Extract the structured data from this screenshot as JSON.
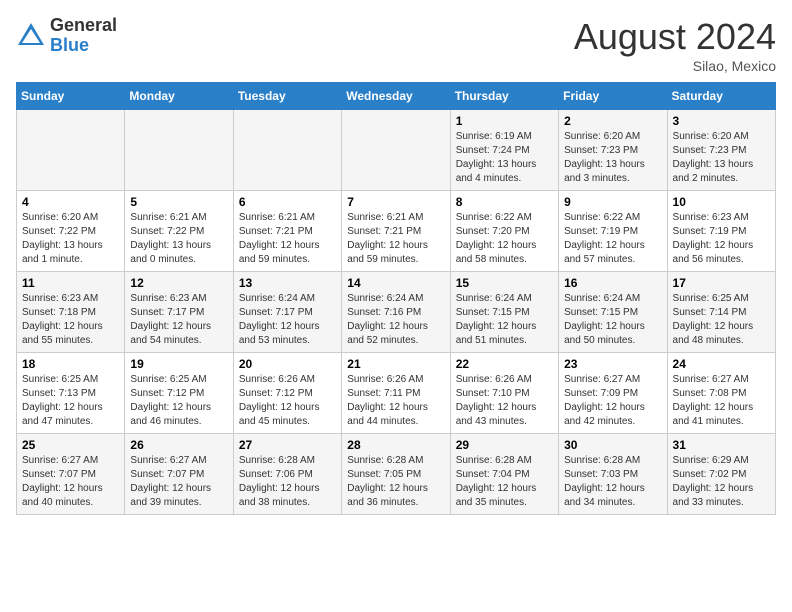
{
  "header": {
    "logo_general": "General",
    "logo_blue": "Blue",
    "month_title": "August 2024",
    "location": "Silao, Mexico"
  },
  "days_of_week": [
    "Sunday",
    "Monday",
    "Tuesday",
    "Wednesday",
    "Thursday",
    "Friday",
    "Saturday"
  ],
  "weeks": [
    [
      {
        "day": "",
        "info": ""
      },
      {
        "day": "",
        "info": ""
      },
      {
        "day": "",
        "info": ""
      },
      {
        "day": "",
        "info": ""
      },
      {
        "day": "1",
        "info": "Sunrise: 6:19 AM\nSunset: 7:24 PM\nDaylight: 13 hours and 4 minutes."
      },
      {
        "day": "2",
        "info": "Sunrise: 6:20 AM\nSunset: 7:23 PM\nDaylight: 13 hours and 3 minutes."
      },
      {
        "day": "3",
        "info": "Sunrise: 6:20 AM\nSunset: 7:23 PM\nDaylight: 13 hours and 2 minutes."
      }
    ],
    [
      {
        "day": "4",
        "info": "Sunrise: 6:20 AM\nSunset: 7:22 PM\nDaylight: 13 hours and 1 minute."
      },
      {
        "day": "5",
        "info": "Sunrise: 6:21 AM\nSunset: 7:22 PM\nDaylight: 13 hours and 0 minutes."
      },
      {
        "day": "6",
        "info": "Sunrise: 6:21 AM\nSunset: 7:21 PM\nDaylight: 12 hours and 59 minutes."
      },
      {
        "day": "7",
        "info": "Sunrise: 6:21 AM\nSunset: 7:21 PM\nDaylight: 12 hours and 59 minutes."
      },
      {
        "day": "8",
        "info": "Sunrise: 6:22 AM\nSunset: 7:20 PM\nDaylight: 12 hours and 58 minutes."
      },
      {
        "day": "9",
        "info": "Sunrise: 6:22 AM\nSunset: 7:19 PM\nDaylight: 12 hours and 57 minutes."
      },
      {
        "day": "10",
        "info": "Sunrise: 6:23 AM\nSunset: 7:19 PM\nDaylight: 12 hours and 56 minutes."
      }
    ],
    [
      {
        "day": "11",
        "info": "Sunrise: 6:23 AM\nSunset: 7:18 PM\nDaylight: 12 hours and 55 minutes."
      },
      {
        "day": "12",
        "info": "Sunrise: 6:23 AM\nSunset: 7:17 PM\nDaylight: 12 hours and 54 minutes."
      },
      {
        "day": "13",
        "info": "Sunrise: 6:24 AM\nSunset: 7:17 PM\nDaylight: 12 hours and 53 minutes."
      },
      {
        "day": "14",
        "info": "Sunrise: 6:24 AM\nSunset: 7:16 PM\nDaylight: 12 hours and 52 minutes."
      },
      {
        "day": "15",
        "info": "Sunrise: 6:24 AM\nSunset: 7:15 PM\nDaylight: 12 hours and 51 minutes."
      },
      {
        "day": "16",
        "info": "Sunrise: 6:24 AM\nSunset: 7:15 PM\nDaylight: 12 hours and 50 minutes."
      },
      {
        "day": "17",
        "info": "Sunrise: 6:25 AM\nSunset: 7:14 PM\nDaylight: 12 hours and 48 minutes."
      }
    ],
    [
      {
        "day": "18",
        "info": "Sunrise: 6:25 AM\nSunset: 7:13 PM\nDaylight: 12 hours and 47 minutes."
      },
      {
        "day": "19",
        "info": "Sunrise: 6:25 AM\nSunset: 7:12 PM\nDaylight: 12 hours and 46 minutes."
      },
      {
        "day": "20",
        "info": "Sunrise: 6:26 AM\nSunset: 7:12 PM\nDaylight: 12 hours and 45 minutes."
      },
      {
        "day": "21",
        "info": "Sunrise: 6:26 AM\nSunset: 7:11 PM\nDaylight: 12 hours and 44 minutes."
      },
      {
        "day": "22",
        "info": "Sunrise: 6:26 AM\nSunset: 7:10 PM\nDaylight: 12 hours and 43 minutes."
      },
      {
        "day": "23",
        "info": "Sunrise: 6:27 AM\nSunset: 7:09 PM\nDaylight: 12 hours and 42 minutes."
      },
      {
        "day": "24",
        "info": "Sunrise: 6:27 AM\nSunset: 7:08 PM\nDaylight: 12 hours and 41 minutes."
      }
    ],
    [
      {
        "day": "25",
        "info": "Sunrise: 6:27 AM\nSunset: 7:07 PM\nDaylight: 12 hours and 40 minutes."
      },
      {
        "day": "26",
        "info": "Sunrise: 6:27 AM\nSunset: 7:07 PM\nDaylight: 12 hours and 39 minutes."
      },
      {
        "day": "27",
        "info": "Sunrise: 6:28 AM\nSunset: 7:06 PM\nDaylight: 12 hours and 38 minutes."
      },
      {
        "day": "28",
        "info": "Sunrise: 6:28 AM\nSunset: 7:05 PM\nDaylight: 12 hours and 36 minutes."
      },
      {
        "day": "29",
        "info": "Sunrise: 6:28 AM\nSunset: 7:04 PM\nDaylight: 12 hours and 35 minutes."
      },
      {
        "day": "30",
        "info": "Sunrise: 6:28 AM\nSunset: 7:03 PM\nDaylight: 12 hours and 34 minutes."
      },
      {
        "day": "31",
        "info": "Sunrise: 6:29 AM\nSunset: 7:02 PM\nDaylight: 12 hours and 33 minutes."
      }
    ]
  ]
}
